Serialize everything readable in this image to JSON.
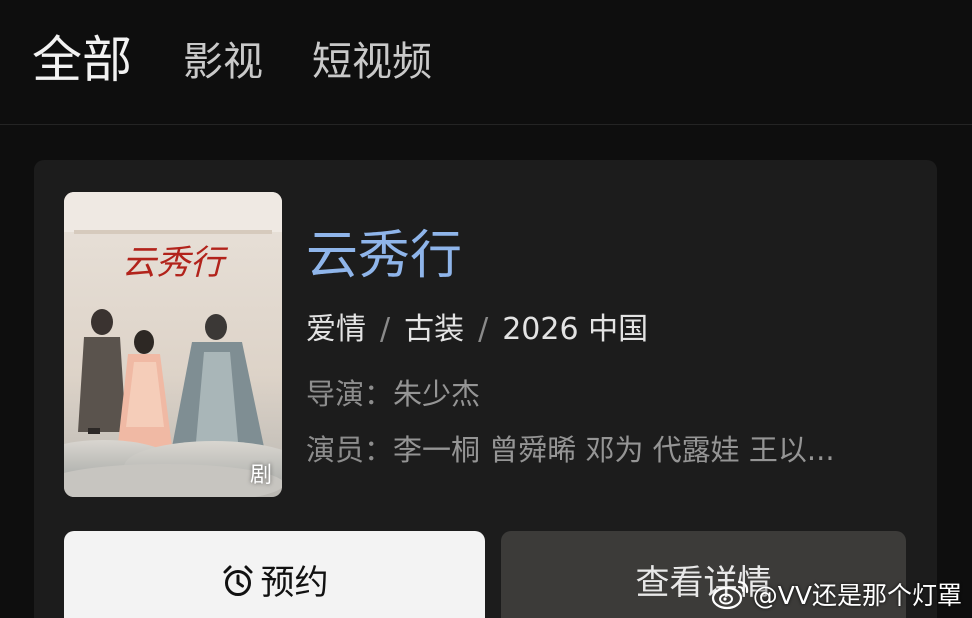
{
  "tabs": {
    "all": "全部",
    "film": "影视",
    "short_video": "短视频"
  },
  "card": {
    "poster": {
      "badge": "剧",
      "art_title": "云秀行"
    },
    "title": "云秀行",
    "meta": {
      "genre1": "爱情",
      "sep": "/",
      "genre2": "古装",
      "year_region": "2026 中国"
    },
    "director": {
      "label": "导演：",
      "value": "朱少杰"
    },
    "cast": {
      "label": "演员：",
      "value": "李一桐 曾舜晞 邓为 代露娃 王以..."
    },
    "buttons": {
      "reserve": "预约",
      "reserve_icon": "alarm-clock-icon",
      "detail": "查看详情"
    }
  },
  "watermark": {
    "text": "@VV还是那个灯罩",
    "icon": "weibo-icon"
  },
  "colors": {
    "background": "#0e0e0e",
    "card": "#1c1c1c",
    "title_accent": "#8fb5ea",
    "reserve_button": "#f3f3f3",
    "detail_button": "#3c3b39"
  }
}
